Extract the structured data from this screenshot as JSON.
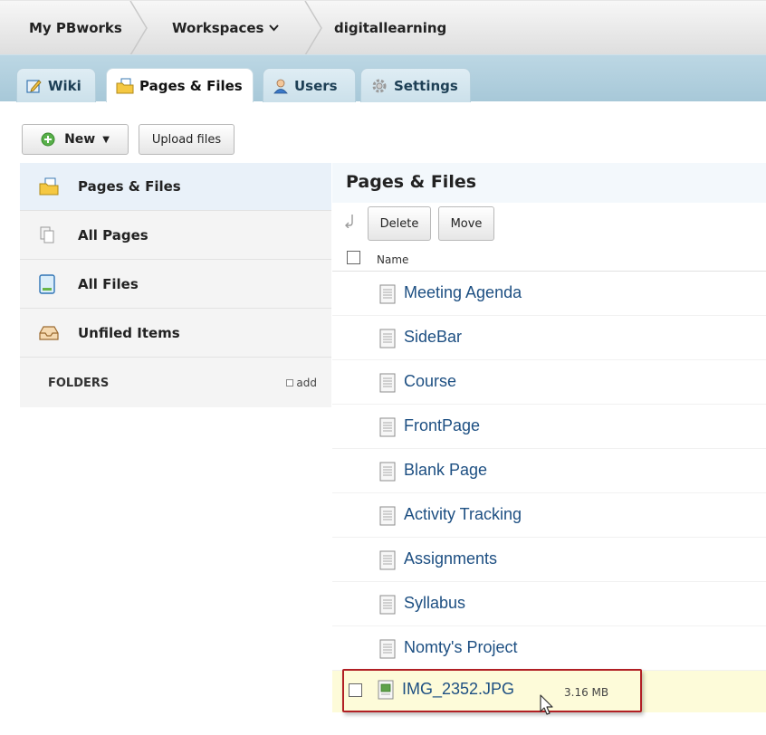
{
  "breadcrumb": {
    "home": "My PBworks",
    "workspaces": "Workspaces",
    "workspace_chevron": "chevron-down-icon",
    "current": "digitallearning"
  },
  "tabs": [
    {
      "label": "Wiki",
      "icon": "pencil-edit-icon",
      "active": false
    },
    {
      "label": "Pages & Files",
      "icon": "folder-page-icon",
      "active": true
    },
    {
      "label": "Users",
      "icon": "user-icon",
      "active": false
    },
    {
      "label": "Settings",
      "icon": "gear-icon",
      "active": false
    }
  ],
  "toolbar": {
    "new_label": "New",
    "new_dropdown": "▼",
    "upload_label": "Upload files"
  },
  "sidebar": {
    "items": [
      {
        "label": "Pages & Files",
        "icon": "folder-page-icon",
        "active": true
      },
      {
        "label": "All Pages",
        "icon": "pages-stack-icon",
        "active": false
      },
      {
        "label": "All Files",
        "icon": "file-icon",
        "active": false
      },
      {
        "label": "Unfiled Items",
        "icon": "inbox-tray-icon",
        "active": false
      }
    ],
    "folders_label": "FOLDERS",
    "add_label": "add"
  },
  "main": {
    "title": "Pages & Files",
    "delete_label": "Delete",
    "move_label": "Move",
    "column_name": "Name",
    "rows": [
      {
        "name": "Meeting Agenda",
        "type": "page"
      },
      {
        "name": "SideBar",
        "type": "page"
      },
      {
        "name": "Course",
        "type": "page"
      },
      {
        "name": "FrontPage",
        "type": "page"
      },
      {
        "name": "Blank Page",
        "type": "page"
      },
      {
        "name": "Activity Tracking",
        "type": "page"
      },
      {
        "name": "Assignments",
        "type": "page"
      },
      {
        "name": "Syllabus",
        "type": "page"
      },
      {
        "name": "Nomty's Project",
        "type": "page"
      }
    ],
    "file_row": {
      "name": "IMG_2352.JPG",
      "size": "3.16 MB",
      "type": "image"
    }
  },
  "colors": {
    "link": "#1d4f82",
    "tabbar": "#b2cfdd",
    "highlight_row": "#fdfbd9",
    "callout_border": "#b11f24"
  }
}
